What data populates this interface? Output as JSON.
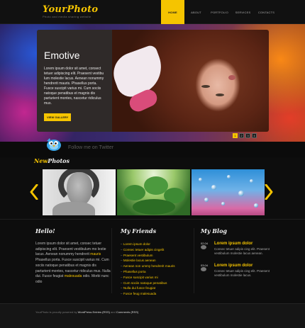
{
  "brand": {
    "logo": "YourPhoto",
    "tagline": "Photo and media sharing website"
  },
  "nav": {
    "items": [
      {
        "label": "Home"
      },
      {
        "label": "About"
      },
      {
        "label": "Portfolio"
      },
      {
        "label": "Services"
      },
      {
        "label": "Contacts"
      }
    ]
  },
  "hero": {
    "title": "Emotive",
    "text": "Lorem ipsum dolor sit amet, consect tetuer adipiscing elit. Praesent vestibu lum molestie lacus. Aenean nonummy hendrerit mauris. Phasellus porta. Fusce suscipit varius mi. Cum sociis natoque penatibus et magnis dis parturient montes, nascetur ridiculus mus.",
    "button": "View Gallery",
    "pages": [
      "1",
      "2",
      "3",
      "4"
    ]
  },
  "twitter": {
    "label": "Follow me on Twitter"
  },
  "new_photos": {
    "title_part1": "New",
    "title_part2": "Photos"
  },
  "hello": {
    "title": "Hello!",
    "line1": "Lorem ipsum dolor sit amet, consec tetuer adipiscing elit. Praesent vestibulum mo lestie lacus. Aenean nonummy hendrerit ",
    "link1": "mauris",
    "line2": "Phasellus porta. Fusce suscipit varius mi. Cum sociis natoque penatibus et magnis dis parturient montes, nascetur ridiculus mus. Nulla dui. Fusce feugiat ",
    "link2": "malesuada",
    "line3": " odio. Morbi nunc odio"
  },
  "friends": {
    "title": "My Friends",
    "items": [
      "Lorem ipsum dolor",
      "Consec tetuer adipis cingelit",
      "Praesent vestibulum",
      "Molestie lacus aenean",
      "Aenean non ummy hendrerit mauris",
      "Phasellus porta",
      "Fusce suscipit varius mi",
      "Cum sociis natoque penatibus",
      "Nulla dui fusce feugiat",
      "Fusce feug malesuada"
    ]
  },
  "blog": {
    "title": "My Blog",
    "posts": [
      {
        "date": "02.04",
        "title": "Lorem ipsum dolor",
        "text": "Consec tetuer adipis cing elit. Praesent vestibulum molestie lacus aenean."
      },
      {
        "date": "03.04",
        "title": "Lorem ipsum dolor",
        "text": "Consec tetuer adipis cing elit. Praesent vestibulum molestie lacus."
      }
    ]
  },
  "footer": {
    "prefix": "YourPhoto is proudly powered by ",
    "wordpress": "WordPress",
    "entries": "Entries (RSS)",
    "and": " and ",
    "comments": "Comments (RSS)"
  },
  "colors": {
    "accent": "#f5c400",
    "background": "#0d0d0d"
  }
}
